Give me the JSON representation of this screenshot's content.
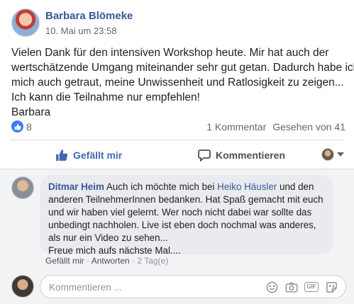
{
  "post": {
    "author": "Barbara Blömeke",
    "timestamp": "10. Mai um 23:58",
    "lines": [
      "Vielen Dank für den intensiven Workshop heute. Mir hat auch der",
      "wertschätzende Umgang miteinander sehr gut getan. Dadurch habe ich",
      "mich auch getraut, meine Unwissenheit und Ratlosigkeit zu zeigen...",
      "Ich kann die Teilnahme nur empfehlen!",
      "Barbara"
    ],
    "like_count": "8",
    "comment_count_label": "1 Kommentar",
    "seen_label": "Gesehen von 41"
  },
  "actions": {
    "like_label": "Gefällt mir",
    "comment_label": "Kommentieren"
  },
  "comment": {
    "author": "Ditmar Heim",
    "text_before_mention": " Auch ich möchte mich bei ",
    "mention": "Heiko Häusler",
    "text_after_mention": " und den",
    "lines": [
      "anderen TeilnehmerInnen bedanken. Hat Spaß gemacht mit euch",
      "und wir haben viel gelernt. Wer noch nicht dabei war sollte das",
      "unbedingt nachholen. Live ist eben doch nochmal was anderes,",
      "als nur ein Video zu sehen...",
      "Freue mich aufs nächste Mal...."
    ],
    "like_label": "Gefällt mir",
    "reply_label": "Antworten",
    "age": "2 Tag(e)"
  },
  "reply_box": {
    "placeholder": "Kommentieren ..."
  },
  "colors": {
    "link_blue": "#365899",
    "like_blue": "#4267b2",
    "muted": "#616770"
  }
}
